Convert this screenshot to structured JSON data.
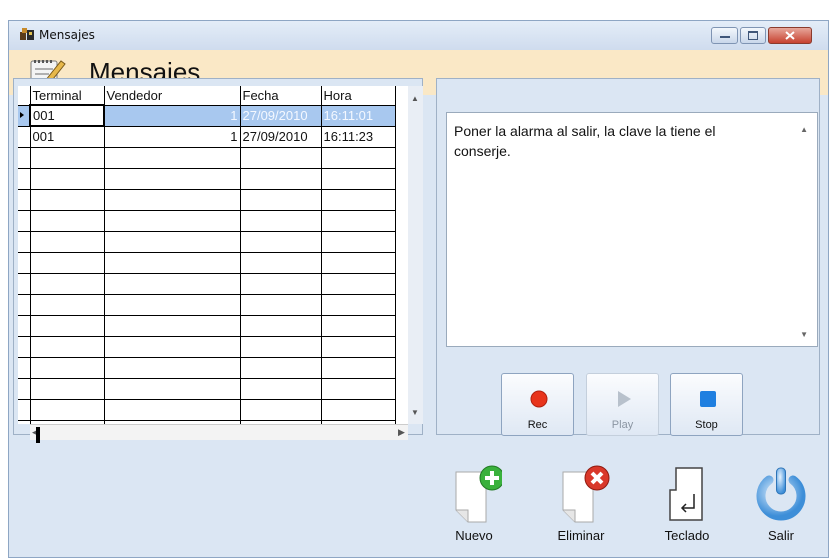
{
  "window": {
    "title": "Mensajes",
    "heading": "Mensajes"
  },
  "grid": {
    "columns": [
      "Terminal",
      "Vendedor",
      "Fecha",
      "Hora"
    ],
    "rows": [
      {
        "terminal": "001",
        "vendedor": "1",
        "fecha": "27/09/2010",
        "hora": "16:11:01",
        "selected": true
      },
      {
        "terminal": "001",
        "vendedor": "1",
        "fecha": "27/09/2010",
        "hora": "16:11:23",
        "selected": false
      }
    ]
  },
  "message": {
    "text": "Poner la alarma al salir, la clave la tiene el conserje."
  },
  "media_buttons": {
    "rec": "Rec",
    "play": "Play",
    "stop": "Stop"
  },
  "actions": {
    "nuevo": "Nuevo",
    "eliminar": "Eliminar",
    "teclado": "Teclado",
    "salir": "Salir"
  },
  "colors": {
    "header_bg": "#fae8c6",
    "window_bg": "#dbe6f3",
    "selection": "#a8c8ef",
    "rec_red": "#e8341c",
    "stop_blue": "#1f7fe0",
    "nuevo_green": "#3ab13c",
    "eliminar_red": "#d9382a"
  },
  "icons": [
    "app-icon",
    "notepad-pencil-icon",
    "minimize-icon",
    "maximize-icon",
    "close-icon",
    "record-icon",
    "play-icon",
    "stop-icon",
    "add-document-icon",
    "delete-document-icon",
    "keyboard-enter-icon",
    "power-icon"
  ]
}
